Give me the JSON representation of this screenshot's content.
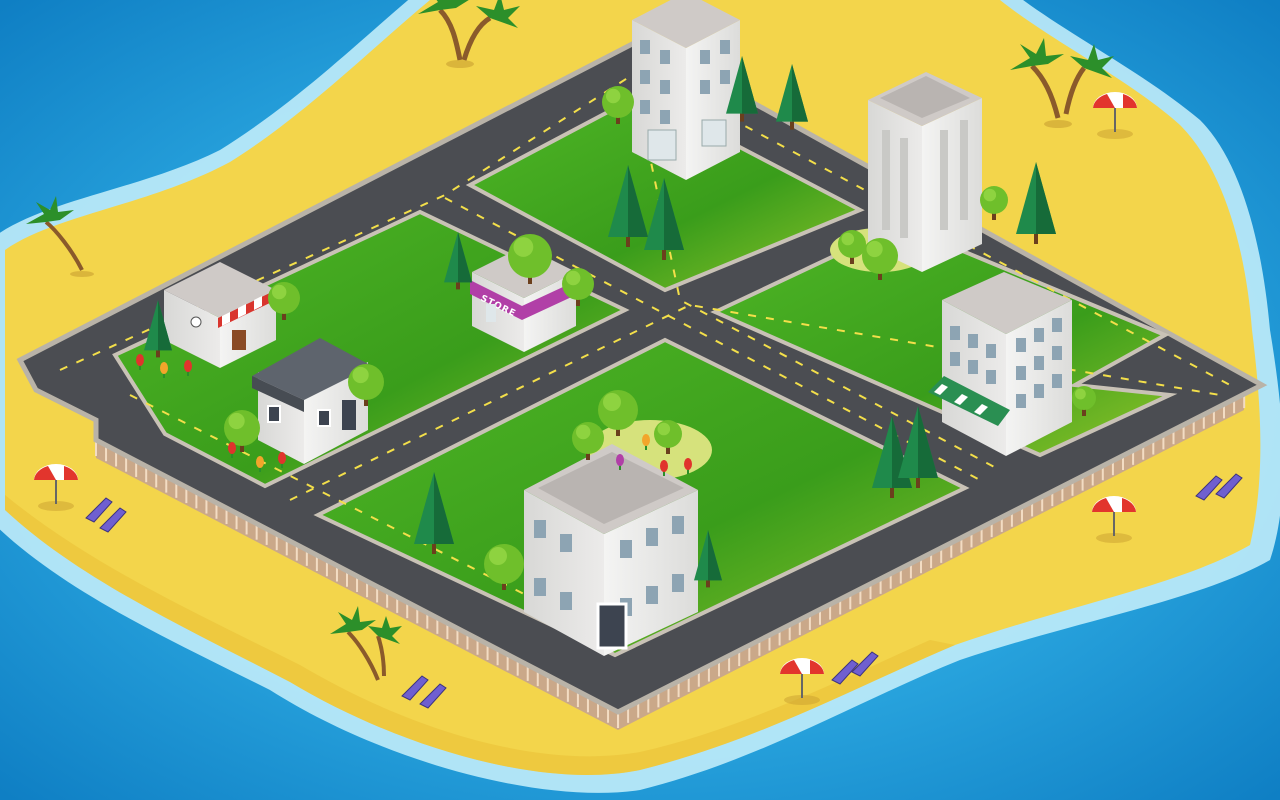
{
  "game": {
    "scene": "isometric-island-town",
    "store_sign": "STORE"
  },
  "colors": {
    "ocean_deep": "#1386c9",
    "ocean_shallow": "#3ec3ee",
    "foam": "#c9f1fb",
    "sand": "#f3d54b",
    "sand_dark": "#e2b82f",
    "grass": "#3fa51e",
    "grass_light": "#9ccc2c",
    "road": "#4b4d52",
    "road_edge": "#b9b3a8",
    "road_line": "#f3df4a",
    "fence": "#e7c5a6",
    "building_wall": "#e9e9e7",
    "building_roof": "#c9c5c3",
    "store_accent": "#b13fa7",
    "awning_red": "#d9352e",
    "awning_green": "#2a8f52",
    "tree_cone": "#1f8a4b",
    "tree_round": "#6fbf2b"
  },
  "icons": [
    "palm-tree-icon",
    "beach-umbrella-icon",
    "deck-chair-icon",
    "cone-tree-icon",
    "round-tree-icon",
    "tulip-icon"
  ]
}
